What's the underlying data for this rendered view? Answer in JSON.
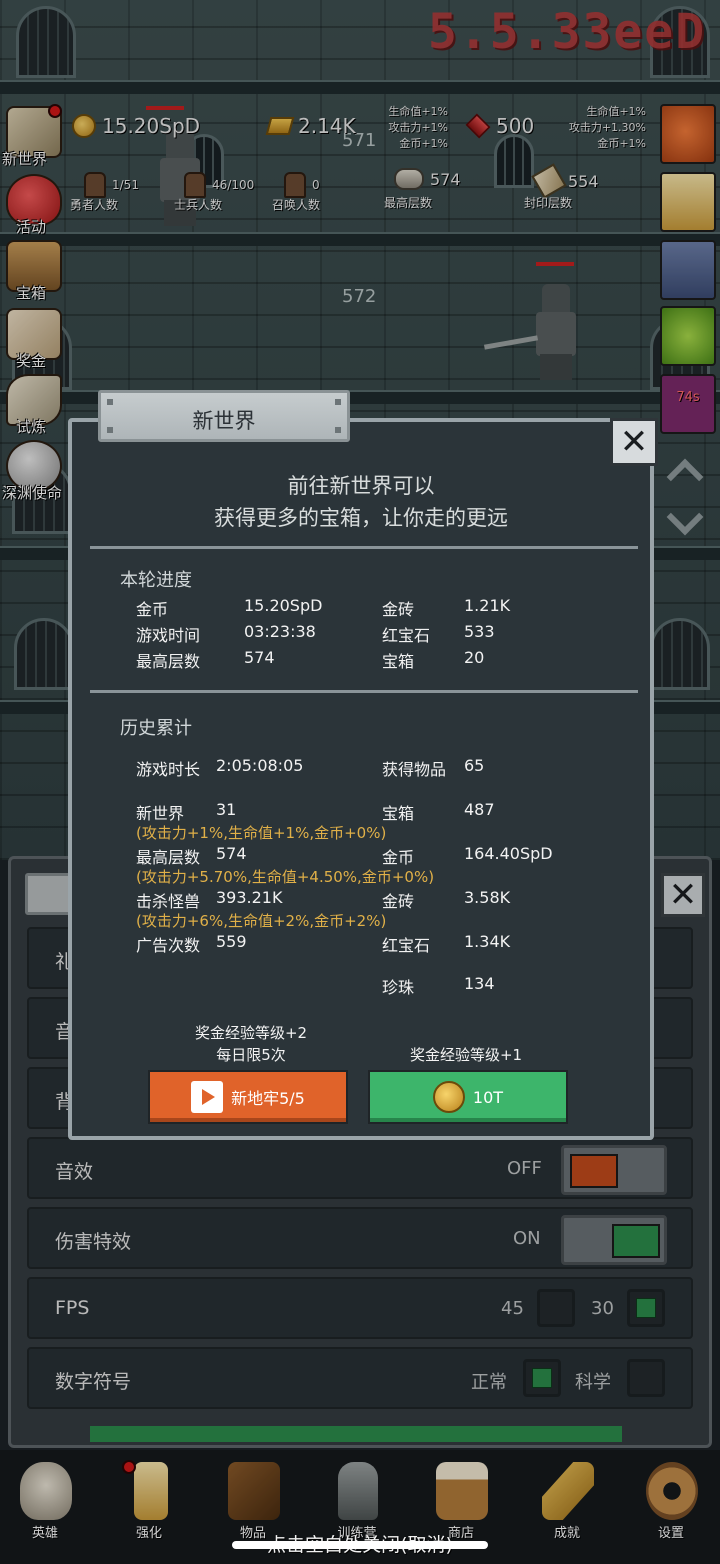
{
  "hud": {
    "power_display": "5.5.33eeD",
    "gold": "15.20SpD",
    "brick": "2.14K",
    "ruby": "500",
    "bonus_left": [
      "生命值+1%",
      "攻击力+1%",
      "金币+1%"
    ],
    "bonus_right": [
      "生命值+1%",
      "攻击力+1.30%",
      "金币+1%"
    ],
    "floor_upper": "571",
    "floor_lower": "572",
    "heroes": {
      "value": "1/51",
      "label": "勇者人数"
    },
    "soldiers": {
      "value": "46/100",
      "label": "士兵人数"
    },
    "summons": {
      "value": "0",
      "label": "召唤人数"
    },
    "max_floor": {
      "value": "574",
      "label": "最高层数"
    },
    "sealed_floor": {
      "value": "554",
      "label": "封印层数"
    },
    "right_timer": "74s"
  },
  "left_menu": [
    "新世界",
    "活动",
    "宝箱",
    "奖金",
    "试炼",
    "深渊使命"
  ],
  "dialog": {
    "title": "新世界",
    "intro_line1": "前往新世界可以",
    "intro_line2": "获得更多的宝箱，让你走的更远",
    "round_title": "本轮进度",
    "round": [
      {
        "k": "金币",
        "v": "15.20SpD",
        "k2": "金砖",
        "v2": "1.21K"
      },
      {
        "k": "游戏时间",
        "v": "03:23:38",
        "k2": "红宝石",
        "v2": "533"
      },
      {
        "k": "最高层数",
        "v": "574",
        "k2": "宝箱",
        "v2": "20"
      }
    ],
    "history_title": "历史累计",
    "history": {
      "playtime": {
        "k": "游戏时长",
        "v": "2:05:08:05"
      },
      "items": {
        "k": "获得物品",
        "v": "65"
      },
      "newworld": {
        "k": "新世界",
        "v": "31"
      },
      "chest": {
        "k": "宝箱",
        "v": "487"
      },
      "newworld_bonus": "(攻击力+1%,生命值+1%,金币+0%)",
      "maxfloor": {
        "k": "最高层数",
        "v": "574"
      },
      "gold": {
        "k": "金币",
        "v": "164.40SpD"
      },
      "maxfloor_bonus": "(攻击力+5.70%,生命值+4.50%,金币+0%)",
      "kills": {
        "k": "击杀怪兽",
        "v": "393.21K"
      },
      "brick": {
        "k": "金砖",
        "v": "3.58K"
      },
      "kills_bonus": "(攻击力+6%,生命值+2%,金币+2%)",
      "ads": {
        "k": "广告次数",
        "v": "559"
      },
      "ruby": {
        "k": "红宝石",
        "v": "1.34K"
      },
      "pearl": {
        "k": "珍珠",
        "v": "134"
      }
    },
    "left_caption1": "奖金经验等级+2",
    "left_caption2": "每日限5次",
    "left_button": "新地牢5/5",
    "right_caption": "奖金经验等级+1",
    "right_button": "10T"
  },
  "settings": {
    "rows": [
      {
        "name": "礼"
      },
      {
        "name": "音"
      },
      {
        "name": "背"
      },
      {
        "name": "音效",
        "value": "OFF"
      },
      {
        "name": "伤害特效",
        "value": "ON"
      },
      {
        "name": "FPS",
        "opt1": "45",
        "opt2": "30"
      },
      {
        "name": "数字符号",
        "opt1": "正常",
        "opt2": "科学"
      }
    ]
  },
  "bottom_nav": [
    "英雄",
    "强化",
    "物品",
    "训练营",
    "商店",
    "成就",
    "设置"
  ],
  "hint": "点击空白处关闭(取消)",
  "colors": {
    "orange": "#e0632a",
    "green": "#3db56b",
    "bonus_text": "#e0b048"
  }
}
